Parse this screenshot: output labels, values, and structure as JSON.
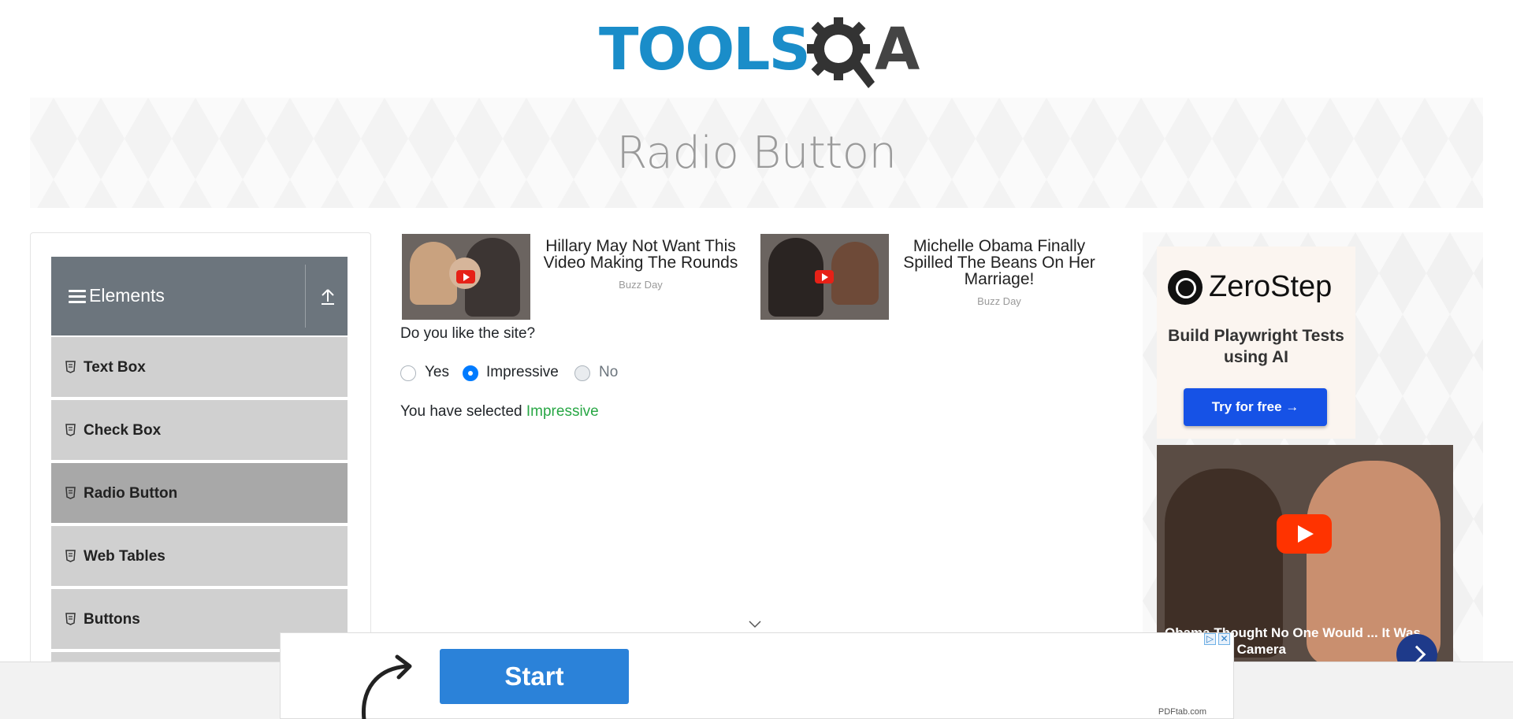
{
  "logo": {
    "text": "TOOLS",
    "suffix": "A"
  },
  "banner": {
    "title": "Radio Button"
  },
  "sidebar": {
    "group_title": "Elements",
    "items": [
      {
        "label": "Text Box"
      },
      {
        "label": "Check Box"
      },
      {
        "label": "Radio Button",
        "active": true
      },
      {
        "label": "Web Tables"
      },
      {
        "label": "Buttons"
      }
    ]
  },
  "ads": [
    {
      "title": "Hillary May Not Want This Video Making The Rounds",
      "source": "Buzz Day"
    },
    {
      "title": "Michelle Obama Finally Spilled The Beans On Her Marriage!",
      "source": "Buzz Day"
    }
  ],
  "form": {
    "question": "Do you like the site?",
    "options": [
      {
        "label": "Yes",
        "checked": false,
        "disabled": false
      },
      {
        "label": "Impressive",
        "checked": true,
        "disabled": false
      },
      {
        "label": "No",
        "checked": false,
        "disabled": true
      }
    ],
    "result_prefix": "You have selected",
    "result_value": "Impressive"
  },
  "right_ad": {
    "brand": "ZeroStep",
    "tagline": "Build Playwright Tests using AI",
    "cta": "Try for free →",
    "video_caption": "Obama Thought No One Would ... It Was Caught On Camera"
  },
  "bottom_ad": {
    "cta": "Start",
    "source": "PDFtab.com"
  },
  "colors": {
    "accent": "#007bff",
    "result": "#28a745",
    "brand": "#1a8dc9"
  }
}
